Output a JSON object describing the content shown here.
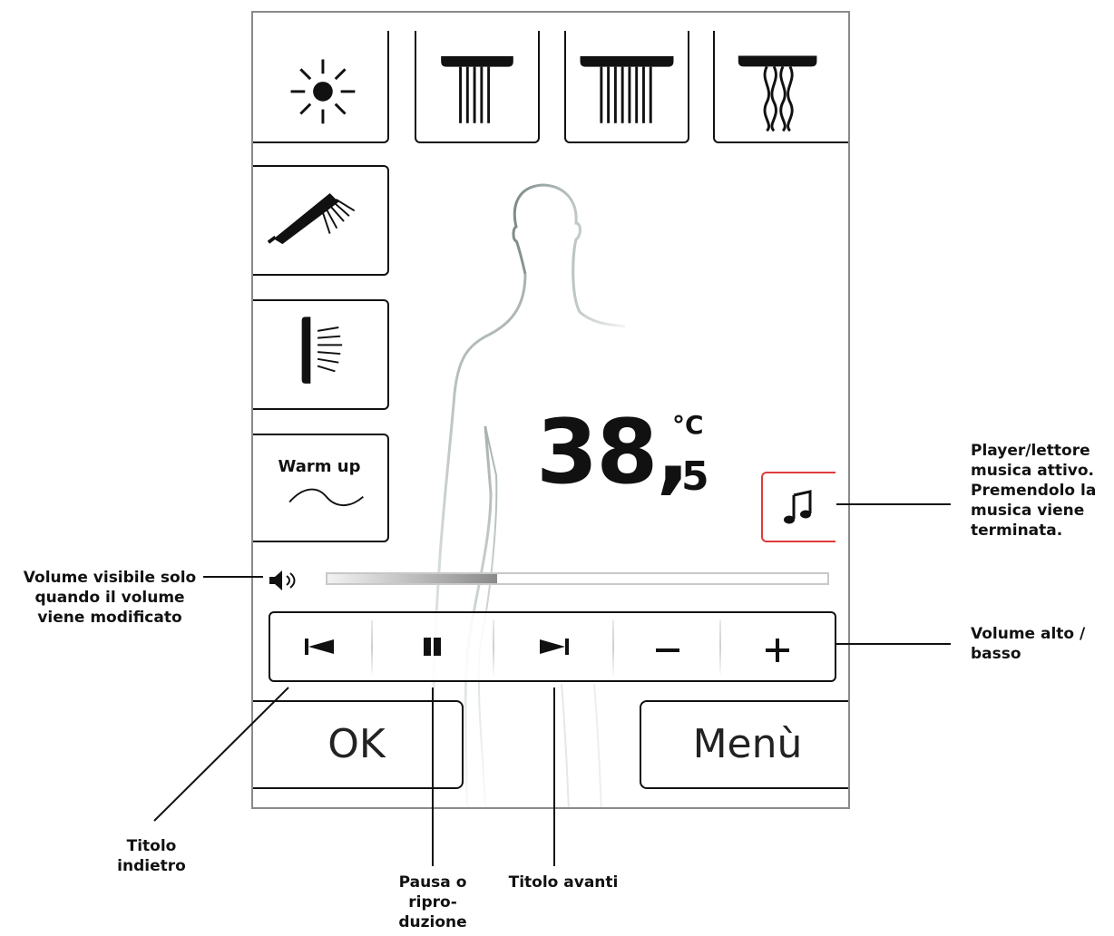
{
  "temperature": {
    "integer": "38,",
    "decimal": "5",
    "unit": "°C"
  },
  "mode_tiles": {
    "warm_up_label": "Warm up"
  },
  "volume": {
    "level_fraction": 0.34
  },
  "buttons": {
    "ok_label": "OK",
    "menu_label": "Menù"
  },
  "callouts": {
    "volume_visible": [
      "Volume visibile solo",
      "quando il volume",
      "viene modificato"
    ],
    "music_player": [
      "Player/lettore",
      "musica attivo.",
      "Premendolo la",
      "musica viene",
      "terminata."
    ],
    "volume_up_down": [
      "Volume alto /",
      "basso"
    ],
    "track_back": [
      "Titolo",
      "indietro"
    ],
    "pause_play": [
      "Pausa o",
      "ripro-",
      "duzione"
    ],
    "track_forward": [
      "Titolo avanti"
    ]
  },
  "colors": {
    "music_active_border": "#e03a3a",
    "frame": "#8a8a8a"
  },
  "icons": [
    "sun-icon",
    "rain-shower-narrow-icon",
    "rain-shower-wide-icon",
    "waterfall-shower-icon",
    "hand-shower-icon",
    "side-jet-icon",
    "wave-icon",
    "music-note-icon",
    "speaker-icon",
    "previous-track-icon",
    "pause-icon",
    "next-track-icon",
    "minus-icon",
    "plus-icon"
  ]
}
